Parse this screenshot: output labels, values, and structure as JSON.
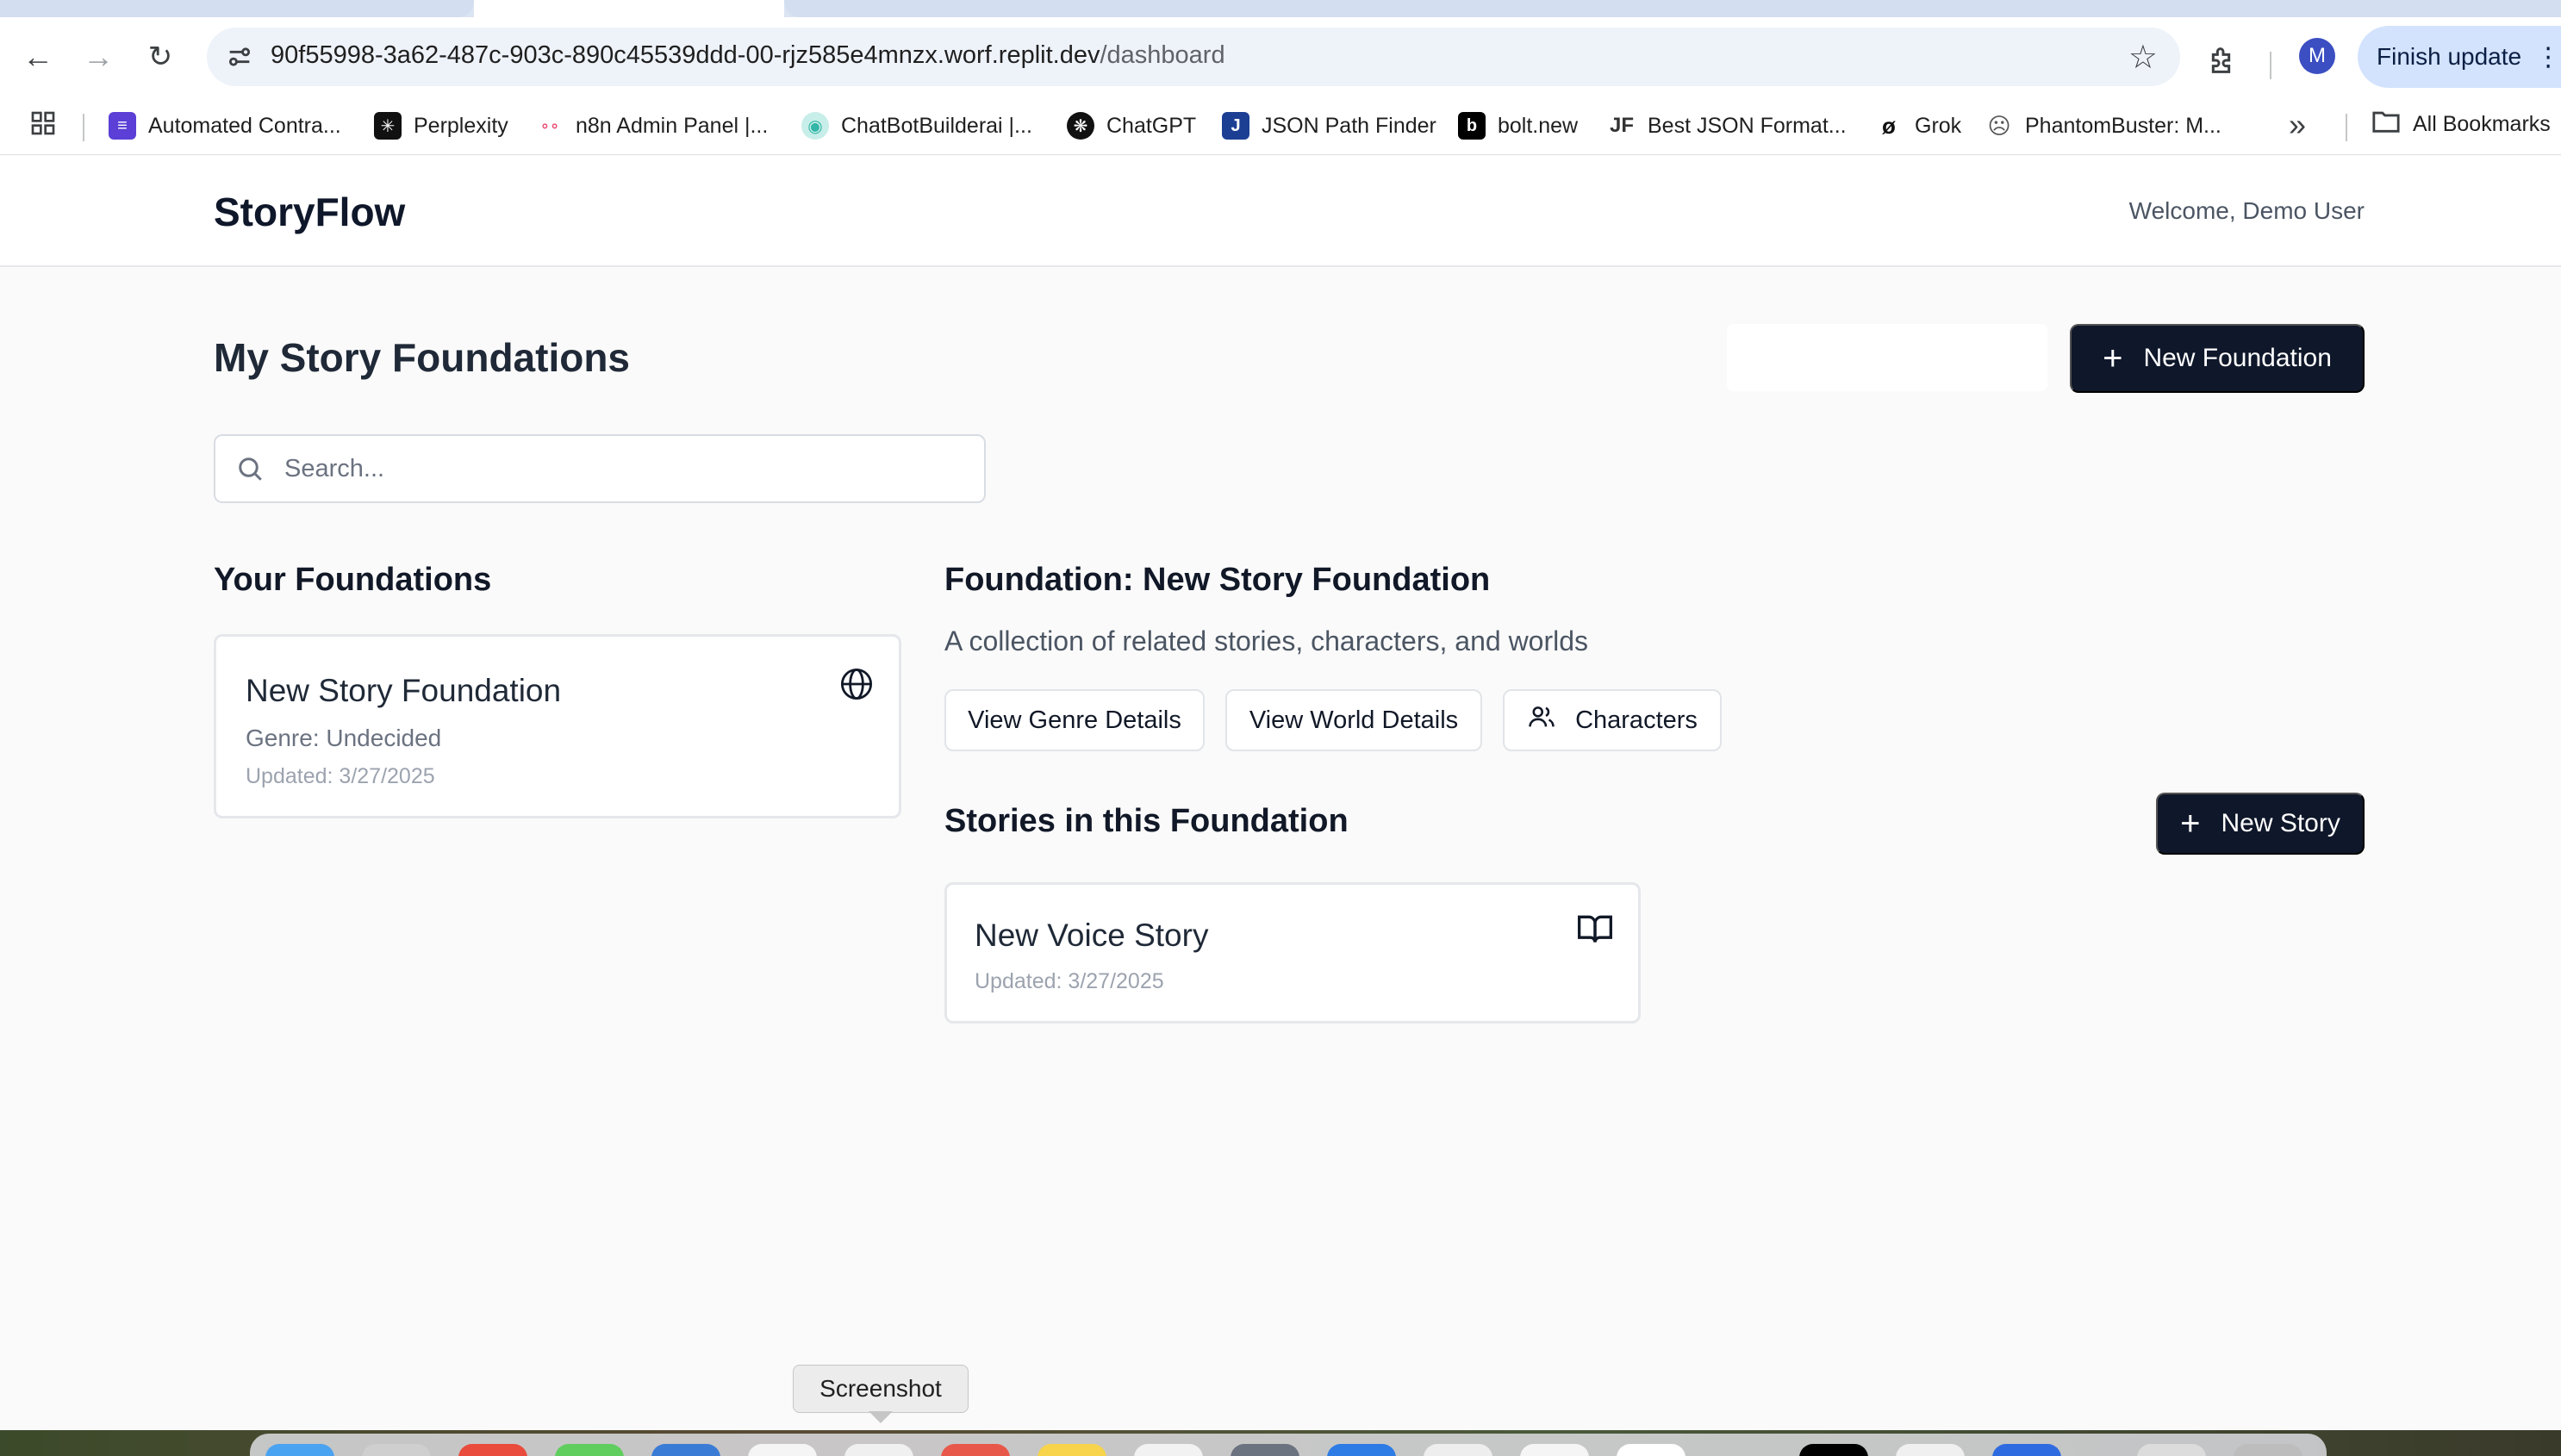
{
  "browser": {
    "url_host": "90f55998-3a62-487c-903c-890c45539ddd-00-rjz585e4mnzx.worf.replit.dev",
    "url_path": "/dashboard",
    "profile_initial": "M",
    "finish_update_label": "Finish update",
    "bookmarks": [
      {
        "label": "Automated Contra...",
        "icon": "list-icon",
        "color": "#5b3fd6"
      },
      {
        "label": "Perplexity",
        "icon": "perplexity-icon",
        "color": "#111111"
      },
      {
        "label": "n8n Admin Panel |...",
        "icon": "n8n-icon",
        "color": "#ea4b71"
      },
      {
        "label": "ChatBotBuilderai |...",
        "icon": "chatbotbuilder-icon",
        "color": "#33b6a8"
      },
      {
        "label": "ChatGPT",
        "icon": "chatgpt-icon",
        "color": "#111111"
      },
      {
        "label": "JSON Path Finder",
        "icon": "json-path-finder-icon",
        "color": "#1c3f94"
      },
      {
        "label": "bolt.new",
        "icon": "bolt-icon",
        "color": "#000000"
      },
      {
        "label": "Best JSON Format...",
        "icon": "jf-icon",
        "color": "#333333"
      },
      {
        "label": "Grok",
        "icon": "grok-icon",
        "color": "#111111"
      },
      {
        "label": "PhantomBuster: M...",
        "icon": "phantombuster-icon",
        "color": "#555555"
      }
    ],
    "all_bookmarks_label": "All Bookmarks"
  },
  "header": {
    "brand": "StoryFlow",
    "welcome": "Welcome, Demo User"
  },
  "main": {
    "title": "My Story Foundations",
    "new_foundation_label": "New Foundation",
    "search_placeholder": "Search...",
    "foundations_heading": "Your Foundations",
    "foundations": [
      {
        "title": "New Story Foundation",
        "genre": "Genre: Undecided",
        "updated": "Updated: 3/27/2025"
      }
    ],
    "selected": {
      "heading": "Foundation: New Story Foundation",
      "description": "A collection of related stories, characters, and worlds",
      "view_genre_label": "View Genre Details",
      "view_world_label": "View World Details",
      "characters_label": "Characters"
    },
    "stories_heading": "Stories in this Foundation",
    "new_story_label": "New Story",
    "stories": [
      {
        "title": "New Voice Story",
        "updated": "Updated: 3/27/2025"
      }
    ]
  },
  "os": {
    "tooltip": "Screenshot"
  },
  "colors": {
    "primary_button": "#0f172a",
    "page_bg": "#fafafa",
    "accent_profile": "#3b4ec2"
  }
}
